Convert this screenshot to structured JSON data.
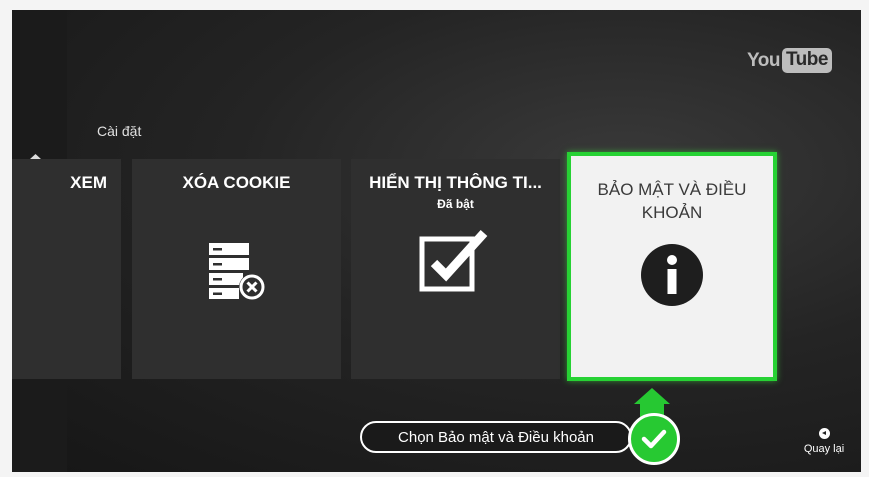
{
  "logo": {
    "you": "You",
    "tube": "Tube"
  },
  "section_title": "Cài đặt",
  "sidebar": {
    "items": [
      "home-icon",
      "subscriptions-icon",
      "headphones-icon",
      "more-icon"
    ],
    "more_glyph": "•••"
  },
  "tiles": [
    {
      "title": "XEM"
    },
    {
      "title": "XÓA COOKIE"
    },
    {
      "title": "HIỂN THỊ THÔNG TI...",
      "subtitle": "Đã bật"
    },
    {
      "title": "BẢO MẬT VÀ ĐIỀU KHOẢN"
    }
  ],
  "callout": {
    "text": "Chọn Bảo mật và Điều khoản"
  },
  "back": {
    "label": "Quay lại"
  },
  "colors": {
    "accent": "#27d234",
    "tile": "#2f2f2f",
    "selected_tile": "#f2f2f2"
  }
}
